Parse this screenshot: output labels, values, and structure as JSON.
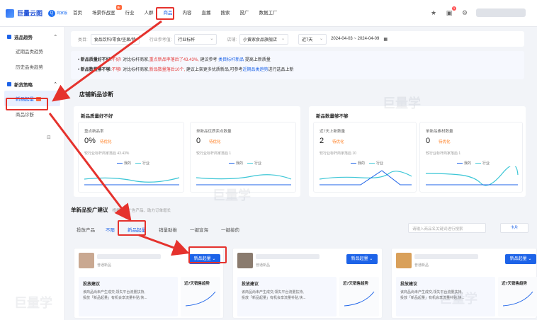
{
  "brand": {
    "name": "巨量云图",
    "tag": "商家版"
  },
  "topnav": [
    "首页",
    "场景作战室",
    "行业",
    "人群",
    "商品",
    "内容",
    "直播",
    "搜索",
    "投广",
    "数据工厂"
  ],
  "topnav_active": 4,
  "notification_count": "3",
  "sidebar": {
    "groups": [
      {
        "label": "选品趋势",
        "items": [
          "近期品类趋势",
          "历史品类趋势"
        ]
      },
      {
        "label": "新货策略",
        "items": [
          "新品起量",
          "商品诊断"
        ]
      }
    ],
    "active_item": "新品起量"
  },
  "filters": {
    "category_label": "类目:",
    "category_value": "食品饮料/零食/坚果/特",
    "industry_label": "行业参考值:",
    "industry_value": "行业标杆",
    "store_label": "店铺:",
    "store_value": "小黄家食品旗舰店",
    "period": "近7天",
    "date_range": "2024-04-03 ~ 2024-04-09"
  },
  "notices": [
    {
      "prefix": "新品质量好不好:",
      "status": "不好!",
      "mid": "对比标杆商家,",
      "red": "重点新品率落后了43.43%,",
      "tail": "建议参考",
      "link": "类目标杆新品",
      "end": "提高上新质量"
    },
    {
      "prefix": "新品数量够不够:",
      "status": "不够!",
      "mid": "对比标杆商家,",
      "red": "新品数量落后10个,",
      "tail": "建议上架更多优质新品,可参考",
      "link": "近期品类趋势",
      "end": "进行选品上新"
    }
  ],
  "diagnosis": {
    "title": "店铺新品诊断",
    "quality_title": "新品质量好不好",
    "quantity_title": "新品数量够不够",
    "legend": [
      "我的",
      "行业"
    ],
    "metrics": [
      {
        "label": "重点新品率",
        "value": "0%",
        "status": "待优化",
        "sub": "较行业标杆商家落后 43.43%"
      },
      {
        "label": "单新品优质卖点数量",
        "value": "0",
        "status": "待优化",
        "sub": "较行业标杆商家落后 1"
      },
      {
        "label": "近7天上新数量",
        "value": "2",
        "status": "待优化",
        "sub": "较行业标杆商家落后 10"
      },
      {
        "label": "单新品素材数量",
        "value": "0",
        "status": "待优化",
        "sub": "较行业标杆商家落后 1"
      }
    ]
  },
  "launch": {
    "title": "单新品投广建议",
    "subtitle": "根据新品广告产品、助力订单增长",
    "product_label": "投放产品",
    "tabs": [
      "不限",
      "新品起量",
      "销量助推",
      "一键宣海",
      "一键接药"
    ],
    "active_tab": 1,
    "search_placeholder": "请输入商品名关键词进行搜索",
    "view_btn": "卡片"
  },
  "cards": [
    {
      "type": "普通新品",
      "btn": "新品起量",
      "advice_title": "投放建议",
      "advice_lines": [
        "该商品尚未产生成交,领失平台流量扶持,",
        "投放「新品起量」有机会享流量补贴,快..."
      ],
      "trend_title": "近7天销售趋势",
      "thumb_color": "#c9a891"
    },
    {
      "type": "普通新品",
      "btn": "新品起量",
      "advice_title": "投放建议",
      "advice_lines": [
        "该商品尚未产生成交,领失平台流量扶持,",
        "投放「新品起量」有机会享流量补贴,快..."
      ],
      "trend_title": "近7天销售趋势",
      "thumb_color": "#8a7b6e"
    },
    {
      "type": "普通新品",
      "btn": "新品起量",
      "advice_title": "投放建议",
      "advice_lines": [
        "该商品尚未产生成交,领失平台流量扶持,",
        "投放「新品起量」有机会享流量补贴,快..."
      ],
      "trend_title": "近7天销售趋势",
      "thumb_color": "#d9a05a"
    }
  ],
  "watermark": "巨量学",
  "colors": {
    "accent": "#1d63e8",
    "warn": "#ff7a1a",
    "alert": "#e43c3c",
    "annotation": "#e5322d"
  }
}
